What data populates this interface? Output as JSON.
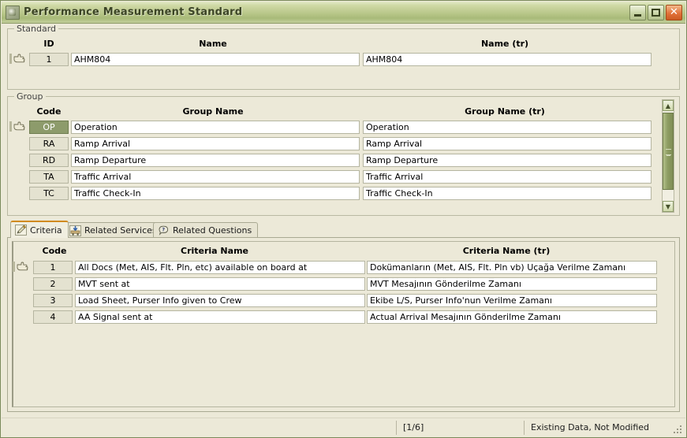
{
  "window": {
    "title": "Performance Measurement Standard",
    "icon": "app-icon",
    "buttons": {
      "minimize": "minimize",
      "maximize": "maximize",
      "close": "✕"
    }
  },
  "standard": {
    "legend": "Standard",
    "headers": {
      "id": "ID",
      "name": "Name",
      "name_tr": "Name (tr)"
    },
    "rows": [
      {
        "id": "1",
        "name": "AHM804",
        "name_tr": "AHM804",
        "selected": false,
        "current": true
      }
    ]
  },
  "group": {
    "legend": "Group",
    "headers": {
      "code": "Code",
      "group_name": "Group Name",
      "group_name_tr": "Group Name (tr)"
    },
    "rows": [
      {
        "code": "OP",
        "name": "Operation",
        "name_tr": "Operation",
        "selected": true,
        "current": true
      },
      {
        "code": "RA",
        "name": "Ramp Arrival",
        "name_tr": "Ramp Arrival",
        "selected": false,
        "current": false
      },
      {
        "code": "RD",
        "name": "Ramp Departure",
        "name_tr": "Ramp Departure",
        "selected": false,
        "current": false
      },
      {
        "code": "TA",
        "name": "Traffic Arrival",
        "name_tr": "Traffic Arrival",
        "selected": false,
        "current": false
      },
      {
        "code": "TC",
        "name": "Traffic Check-In",
        "name_tr": "Traffic Check-In",
        "selected": false,
        "current": false
      }
    ],
    "scrollbar": {
      "up": "▲",
      "down": "▼"
    }
  },
  "tabs": [
    {
      "label": "Criteria",
      "icon": "pencil-icon",
      "active": true
    },
    {
      "label": "Related Services",
      "icon": "cart-down-icon",
      "active": false
    },
    {
      "label": "Related Questions",
      "icon": "question-bubble-icon",
      "active": false
    }
  ],
  "criteria": {
    "headers": {
      "code": "Code",
      "criteria_name": "Criteria Name",
      "criteria_name_tr": "Criteria Name (tr)"
    },
    "rows": [
      {
        "code": "1",
        "name": "All Docs (Met, AIS, Flt. Pln,  etc) available on board at",
        "name_tr": "Dokümanların (Met, AIS, Flt. Pln vb) Uçağa Verilme Zamanı",
        "current": true
      },
      {
        "code": "2",
        "name": "MVT sent at",
        "name_tr": "MVT Mesajının Gönderilme Zamanı",
        "current": false
      },
      {
        "code": "3",
        "name": "Load Sheet, Purser Info given to Crew",
        "name_tr": "Ekibe L/S, Purser Info'nun Verilme Zamanı",
        "current": false
      },
      {
        "code": "4",
        "name": "AA Signal sent at",
        "name_tr": "Actual Arrival Mesajının Gönderilme Zamanı",
        "current": false
      }
    ]
  },
  "statusbar": {
    "record_counter": "[1/6]",
    "state": "Existing Data, Not Modified"
  },
  "colors": {
    "title_accent": "#a8ba78",
    "selection": "#8d9b6b",
    "active_tab_accent": "#d08a20",
    "close_button": "#e2723a",
    "panel_bg": "#ece9d8"
  }
}
